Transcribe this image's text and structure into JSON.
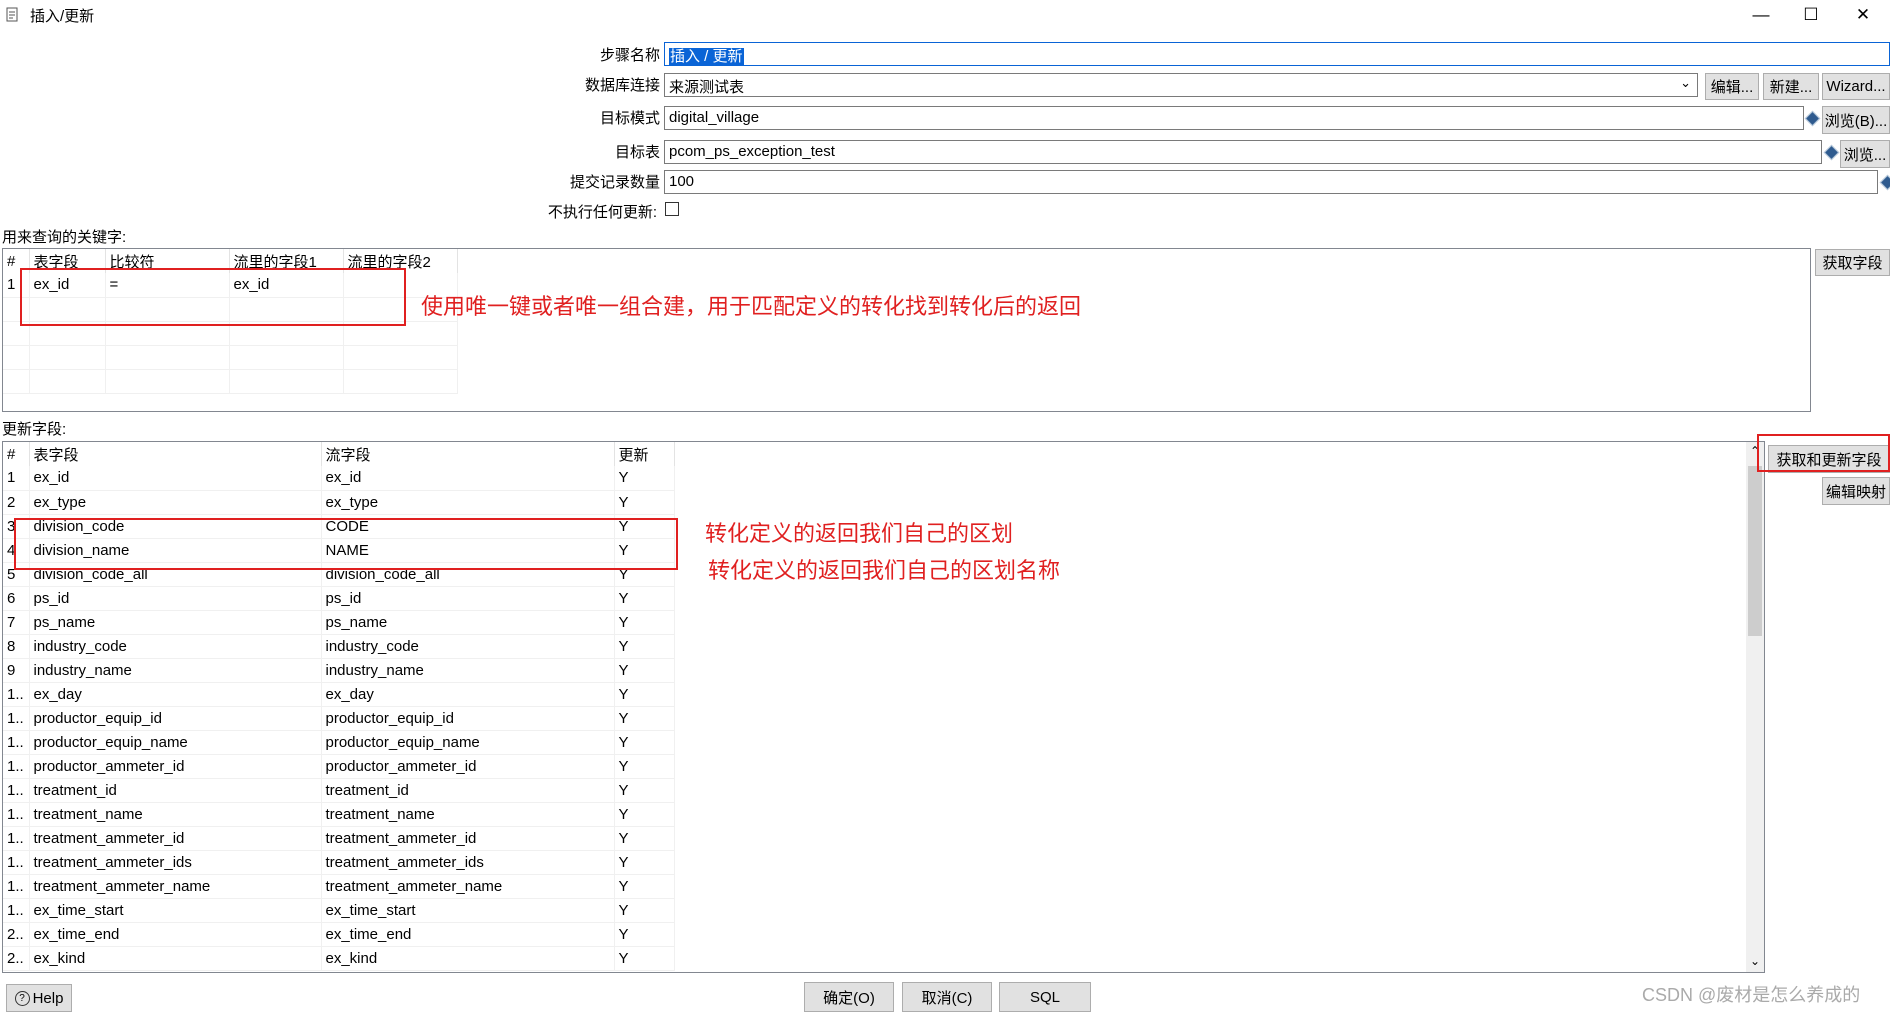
{
  "window": {
    "title": "插入/更新",
    "controls": {
      "minimize": "—",
      "maximize": "☐",
      "close": "✕"
    }
  },
  "form": {
    "step_name_label": "步骤名称",
    "step_name_value": "插入 / 更新",
    "db_conn_label": "数据库连接",
    "db_conn_value": "来源测试表",
    "edit_btn": "编辑...",
    "new_btn": "新建...",
    "wizard_btn": "Wizard...",
    "schema_label": "目标模式",
    "schema_value": "digital_village",
    "browse_b_btn": "浏览(B)...",
    "table_label": "目标表",
    "table_value": "pcom_ps_exception_test",
    "browse_btn": "浏览...",
    "commit_label": "提交记录数量",
    "commit_value": "100",
    "no_update_label": "不执行任何更新:"
  },
  "keys": {
    "section_label": "用来查询的关键字:",
    "get_fields_btn": "获取字段",
    "headers": [
      "#",
      "表字段",
      "比较符",
      "流里的字段1",
      "流里的字段2"
    ],
    "rows": [
      [
        "1",
        "ex_id",
        "=",
        "ex_id",
        ""
      ]
    ]
  },
  "update": {
    "section_label": "更新字段:",
    "get_update_btn": "获取和更新字段",
    "edit_mapping_btn": "编辑映射",
    "headers": [
      "#",
      "表字段",
      "流字段",
      "更新"
    ],
    "rows": [
      [
        "1",
        "ex_id",
        "ex_id",
        "Y"
      ],
      [
        "2",
        "ex_type",
        "ex_type",
        "Y"
      ],
      [
        "3",
        "division_code",
        "CODE",
        "Y"
      ],
      [
        "4",
        "division_name",
        "NAME",
        "Y"
      ],
      [
        "5",
        "division_code_all",
        "division_code_all",
        "Y"
      ],
      [
        "6",
        "ps_id",
        "ps_id",
        "Y"
      ],
      [
        "7",
        "ps_name",
        "ps_name",
        "Y"
      ],
      [
        "8",
        "industry_code",
        "industry_code",
        "Y"
      ],
      [
        "9",
        "industry_name",
        "industry_name",
        "Y"
      ],
      [
        "1..",
        "ex_day",
        "ex_day",
        "Y"
      ],
      [
        "1..",
        "productor_equip_id",
        "productor_equip_id",
        "Y"
      ],
      [
        "1..",
        "productor_equip_name",
        "productor_equip_name",
        "Y"
      ],
      [
        "1..",
        "productor_ammeter_id",
        "productor_ammeter_id",
        "Y"
      ],
      [
        "1..",
        "treatment_id",
        "treatment_id",
        "Y"
      ],
      [
        "1..",
        "treatment_name",
        "treatment_name",
        "Y"
      ],
      [
        "1..",
        "treatment_ammeter_id",
        "treatment_ammeter_id",
        "Y"
      ],
      [
        "1..",
        "treatment_ammeter_ids",
        "treatment_ammeter_ids",
        "Y"
      ],
      [
        "1..",
        "treatment_ammeter_name",
        "treatment_ammeter_name",
        "Y"
      ],
      [
        "1..",
        "ex_time_start",
        "ex_time_start",
        "Y"
      ],
      [
        "2..",
        "ex_time_end",
        "ex_time_end",
        "Y"
      ],
      [
        "2..",
        "ex_kind",
        "ex_kind",
        "Y"
      ]
    ]
  },
  "annotations": {
    "keys_note": "使用唯一键或者唯一组合建，用于匹配定义的转化找到转化后的返回",
    "code_note": "转化定义的返回我们自己的区划",
    "name_note": "转化定义的返回我们自己的区划名称",
    "color": "#e02020"
  },
  "footer": {
    "help_btn": "Help",
    "ok_btn": "确定(O)",
    "cancel_btn": "取消(C)",
    "sql_btn": "SQL",
    "watermark": "CSDN @废材是怎么养成的"
  }
}
